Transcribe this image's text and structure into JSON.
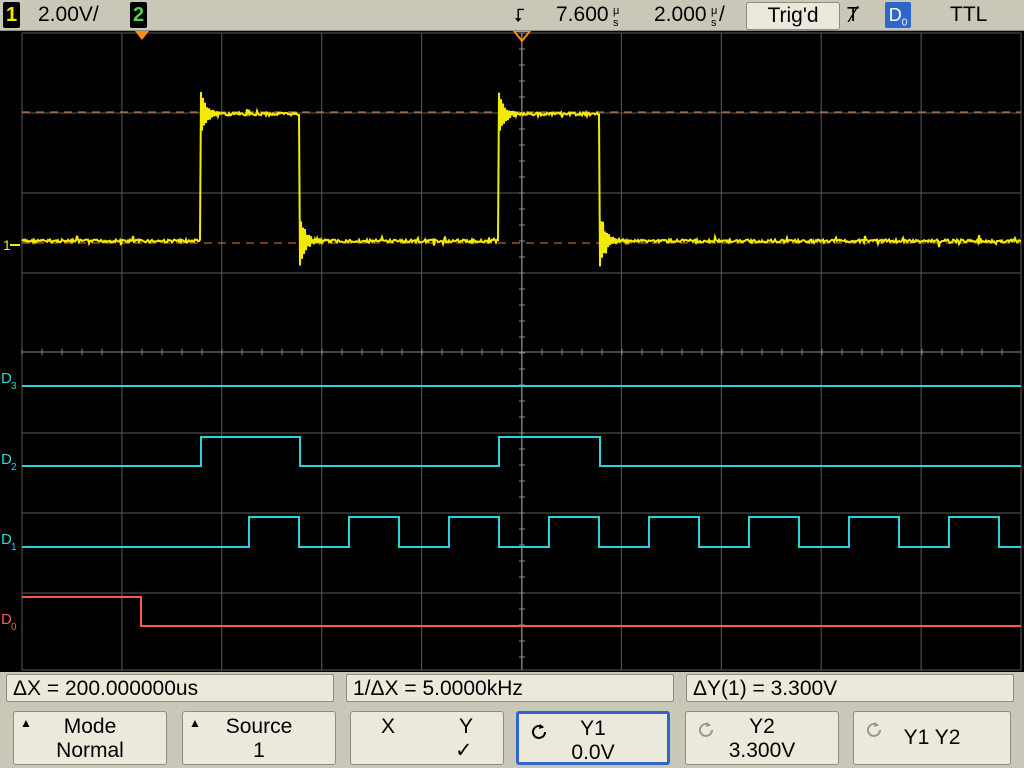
{
  "topbar": {
    "ch1_num": "1",
    "ch1_scale": "2.00V/",
    "ch2_num": "2",
    "trigger_pos": "7.600",
    "trigger_pos_unit": "s",
    "trigger_pos_prefix": "μ",
    "time_scale": "2.000",
    "time_scale_unit": "s",
    "time_scale_prefix": "μ",
    "time_scale_suffix": "/",
    "status": "Trig'd",
    "trigger_source": "D",
    "trigger_source_sub": "0",
    "trigger_type": "TTL"
  },
  "colors": {
    "ch1": "#f2ea00",
    "digital": "#2ad4dc",
    "d0": "#ff5a4a",
    "grid": "#5a5a5a",
    "ch1_box": "#f2ea00",
    "ch2_box": "#4fd24a",
    "d0_box": "#2f66c9"
  },
  "screen": {
    "ch1_marker": "1",
    "digital_labels": [
      {
        "main": "D",
        "sub": "3"
      },
      {
        "main": "D",
        "sub": "2"
      },
      {
        "main": "D",
        "sub": "1"
      },
      {
        "main": "D",
        "sub": "0"
      }
    ]
  },
  "measurements": {
    "dx": "ΔX = 200.000000us",
    "inv_dx": "1/ΔX = 5.0000kHz",
    "dy": "ΔY(1) = 3.300V"
  },
  "softkeys": {
    "mode": {
      "line1": "Mode",
      "line2": "Normal"
    },
    "source": {
      "line1": "Source",
      "line2": "1"
    },
    "xy": {
      "x": "X",
      "y": "Y",
      "check": "✓"
    },
    "y1": {
      "line1": "Y1",
      "line2": "0.0V"
    },
    "y2": {
      "line1": "Y2",
      "line2": "3.300V"
    },
    "y1y2": {
      "line1": "Y1 Y2"
    }
  }
}
